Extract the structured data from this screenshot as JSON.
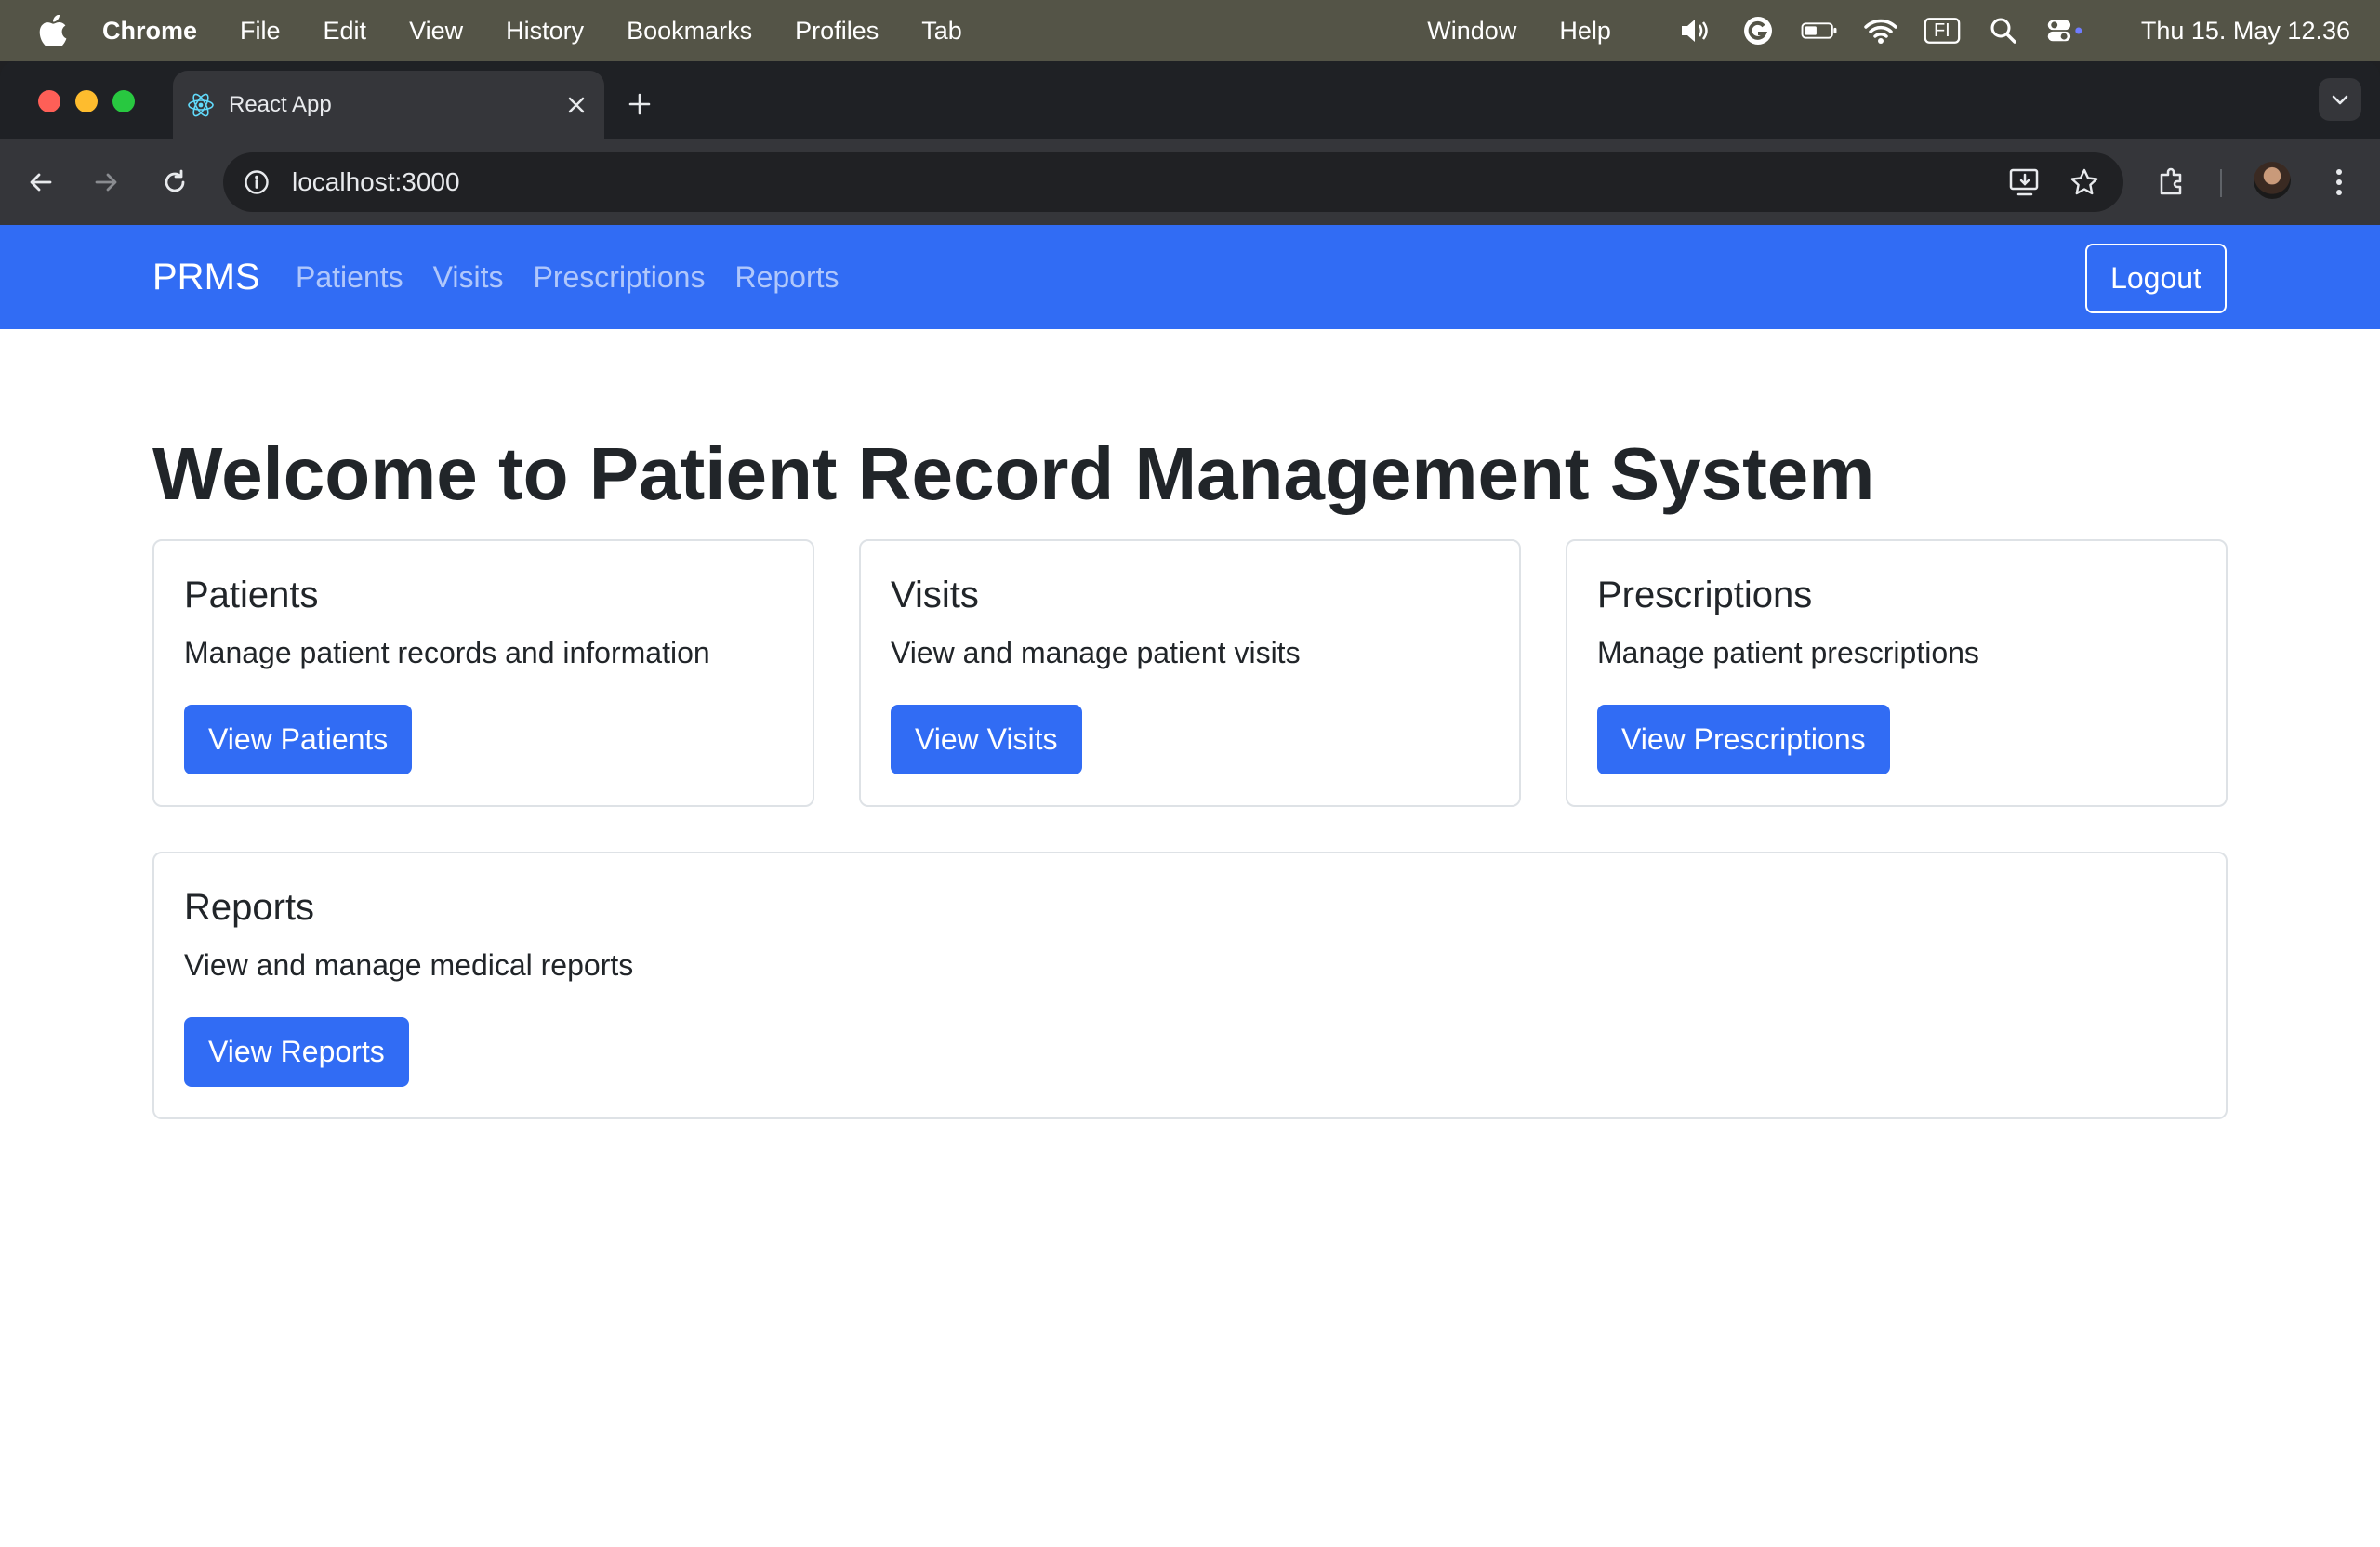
{
  "menubar": {
    "app": "Chrome",
    "items": [
      "File",
      "Edit",
      "View",
      "History",
      "Bookmarks",
      "Profiles",
      "Tab"
    ],
    "right_items": [
      "Window",
      "Help"
    ],
    "input_source": "FI",
    "clock": "Thu 15. May  12.36"
  },
  "browser": {
    "tab_title": "React App",
    "url": "localhost:3000"
  },
  "navbar": {
    "brand": "PRMS",
    "links": [
      "Patients",
      "Visits",
      "Prescriptions",
      "Reports"
    ],
    "logout_label": "Logout"
  },
  "main": {
    "heading": "Welcome to Patient Record Management System",
    "cards": [
      {
        "title": "Patients",
        "text": "Manage patient records and information",
        "button": "View Patients"
      },
      {
        "title": "Visits",
        "text": "View and manage patient visits",
        "button": "View Visits"
      },
      {
        "title": "Prescriptions",
        "text": "Manage patient prescriptions",
        "button": "View Prescriptions"
      },
      {
        "title": "Reports",
        "text": "View and manage medical reports",
        "button": "View Reports"
      }
    ]
  },
  "colors": {
    "primary": "#316cf4",
    "menubar": "#545447",
    "browser_frame": "#1f2125",
    "toolbar": "#35363a"
  }
}
